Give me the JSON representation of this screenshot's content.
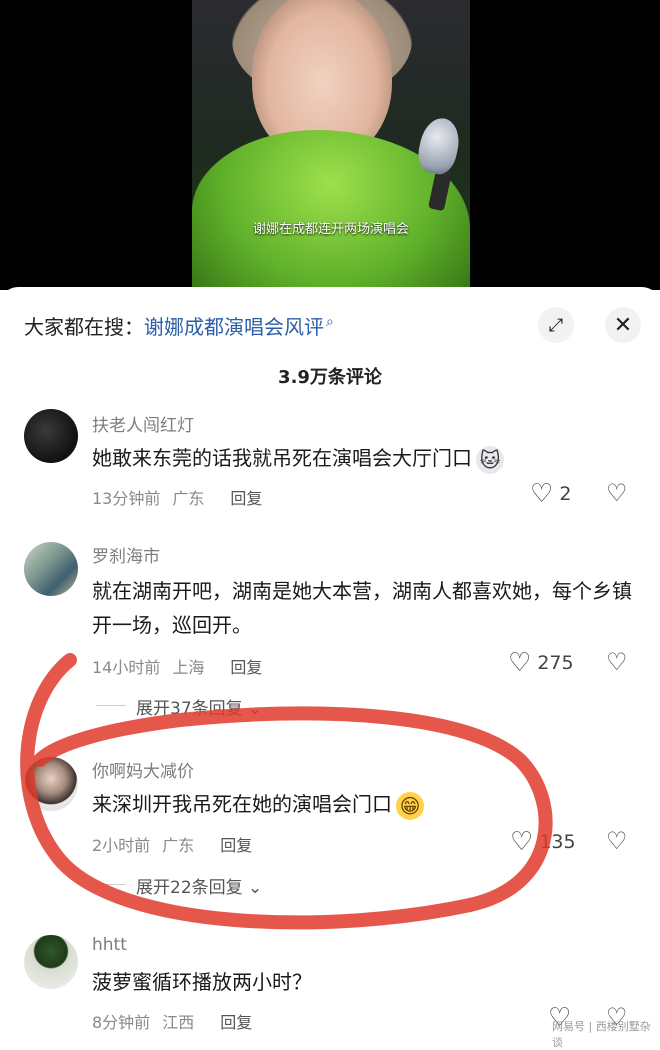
{
  "video": {
    "caption": "谢娜在成都连开两场演唱会"
  },
  "header": {
    "search_prefix": "大家都在搜：",
    "search_term": "谢娜成都演唱会风评",
    "search_icon": "search-icon",
    "expand_icon": "⤢",
    "close_icon": "✕",
    "comment_count": "3.9万条评论"
  },
  "comments": [
    {
      "username": "扶老人闯红灯",
      "text": "她敢来东莞的话我就吊死在演唱会大厅门口",
      "emoji": "cat-face-icon",
      "time": "13分钟前",
      "location": "广东",
      "reply": "回复",
      "likes": "2"
    },
    {
      "username": "罗刹海市",
      "text": "就在湖南开吧，湖南是她大本营，湖南人都喜欢她，每个乡镇开一场，巡回开。",
      "time": "14小时前",
      "location": "上海",
      "reply": "回复",
      "likes": "275",
      "expand": "展开37条回复"
    },
    {
      "username": "你啊妈大减价",
      "text": "来深圳开我吊死在她的演唱会门口",
      "emoji": "grin-face-icon",
      "time": "2小时前",
      "location": "广东",
      "reply": "回复",
      "likes": "135",
      "expand": "展开22条回复"
    },
    {
      "username": "hhtt",
      "text": "菠萝蜜循环播放两小时？",
      "time": "8分钟前",
      "location": "江西",
      "reply": "回复",
      "likes": ""
    }
  ],
  "annotation": {
    "color": "#e03a2a"
  },
  "watermark": "网易号 | 西楼别墅杂谈"
}
